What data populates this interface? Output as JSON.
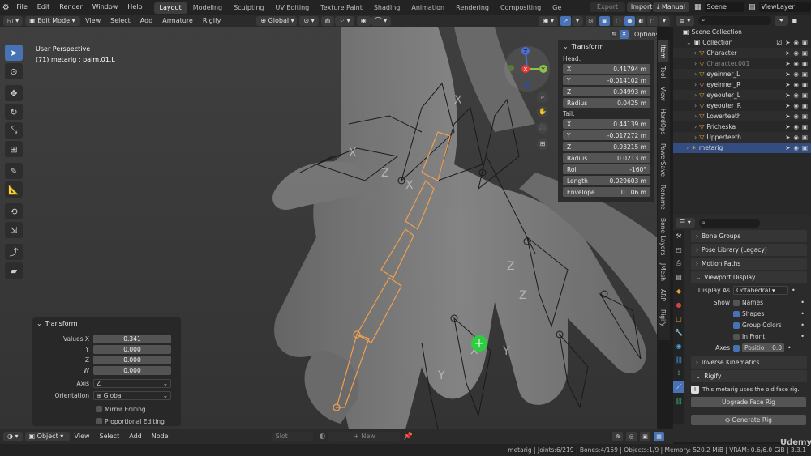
{
  "menu": {
    "items": [
      "File",
      "Edit",
      "Render",
      "Window",
      "Help"
    ],
    "workspaces": [
      "Layout",
      "Modeling",
      "Sculpting",
      "UV Editing",
      "Texture Paint",
      "Shading",
      "Animation",
      "Rendering",
      "Compositing",
      "Ge"
    ],
    "active_workspace": "Layout",
    "export_label": "Export",
    "import_label": "Import",
    "manual_label": "Manual",
    "scene_label": "Scene",
    "viewlayer_label": "ViewLayer"
  },
  "viewport_header": {
    "mode": "Edit Mode",
    "menus": [
      "View",
      "Select",
      "Add",
      "Armature",
      "Rigify"
    ],
    "orientation": "Global",
    "options_label": "Options"
  },
  "viewport": {
    "perspective": "User Perspective",
    "selection_info": "(71) metarig : palm.01.L"
  },
  "transform_panel": {
    "title": "Transform",
    "head_label": "Head:",
    "head": [
      {
        "label": "X",
        "value": "0.41794 m"
      },
      {
        "label": "Y",
        "value": "-0.014102 m"
      },
      {
        "label": "Z",
        "value": "0.94993 m"
      },
      {
        "label": "Radius",
        "value": "0.0425 m"
      }
    ],
    "tail_label": "Tail:",
    "tail": [
      {
        "label": "X",
        "value": "0.44139 m"
      },
      {
        "label": "Y",
        "value": "-0.017272 m"
      },
      {
        "label": "Z",
        "value": "0.93215 m"
      },
      {
        "label": "Radius",
        "value": "0.0213 m"
      },
      {
        "label": "Roll",
        "value": "-160°"
      },
      {
        "label": "Length",
        "value": "0.029603 m"
      },
      {
        "label": "Envelope",
        "value": "0.106 m"
      }
    ]
  },
  "vertical_tabs": [
    "Item",
    "Tool",
    "View",
    "HardOps",
    "PowerSave",
    "Rename",
    "Bone Layers",
    "JMesh",
    "ARP",
    "Rigify"
  ],
  "outliner": {
    "title": "Scene Collection",
    "items": [
      {
        "name": "Collection",
        "indent": 1
      },
      {
        "name": "Character",
        "indent": 2
      },
      {
        "name": "Character.001",
        "indent": 2
      },
      {
        "name": "eyeinner_L",
        "indent": 2
      },
      {
        "name": "eyeinner_R",
        "indent": 2
      },
      {
        "name": "eyeouter_L",
        "indent": 2
      },
      {
        "name": "eyeouter_R",
        "indent": 2
      },
      {
        "name": "Lowerteeth",
        "indent": 2
      },
      {
        "name": "Pricheska",
        "indent": 2
      },
      {
        "name": "Upperteeth",
        "indent": 2
      },
      {
        "name": "metarig",
        "indent": 1
      }
    ]
  },
  "properties": {
    "panels": [
      "Bone Groups",
      "Pose Library (Legacy)",
      "Motion Paths"
    ],
    "viewport_display": {
      "title": "Viewport Display",
      "display_as_label": "Display As",
      "display_as_value": "Octahedral",
      "show_label": "Show",
      "show_options": [
        {
          "label": "Names",
          "checked": false
        },
        {
          "label": "Shapes",
          "checked": true
        },
        {
          "label": "Group Colors",
          "checked": true
        },
        {
          "label": "In Front",
          "checked": false
        }
      ],
      "axes_label": "Axes",
      "axes_field_label": "Positio",
      "axes_field_value": "0.0"
    },
    "inverse_kinematics": "Inverse Kinematics",
    "rigify": {
      "title": "Rigify",
      "info": "This metarig uses the old face rig.",
      "upgrade_button": "Upgrade Face Rig",
      "generate_button": "Generate Rig"
    }
  },
  "redo_panel": {
    "title": "Transform",
    "values": [
      {
        "label": "Values X",
        "value": "0.341"
      },
      {
        "label": "Y",
        "value": "0.000"
      },
      {
        "label": "Z",
        "value": "0.000"
      },
      {
        "label": "W",
        "value": "0.000"
      }
    ],
    "axis_label": "Axis",
    "axis_value": "Z",
    "orientation_label": "Orientation",
    "orientation_value": "Global",
    "mirror_label": "Mirror Editing",
    "proportional_label": "Proportional Editing"
  },
  "bottom_header": {
    "mode": "Object",
    "menus": [
      "View",
      "Select",
      "Add",
      "Node"
    ],
    "slot_label": "Slot",
    "new_label": "New"
  },
  "status_bar": {
    "text": "metarig | Joints:6/219 | Bones:4/159 | Objects:1/9 | Memory: 520.2 MiB | VRAM: 0.6/6.0 GiB | 3.3.1"
  },
  "watermark": "Udemy",
  "colors": {
    "accent": "#4772b3",
    "bone_selected": "#f0a050",
    "cursor_green": "#2ecc40"
  }
}
